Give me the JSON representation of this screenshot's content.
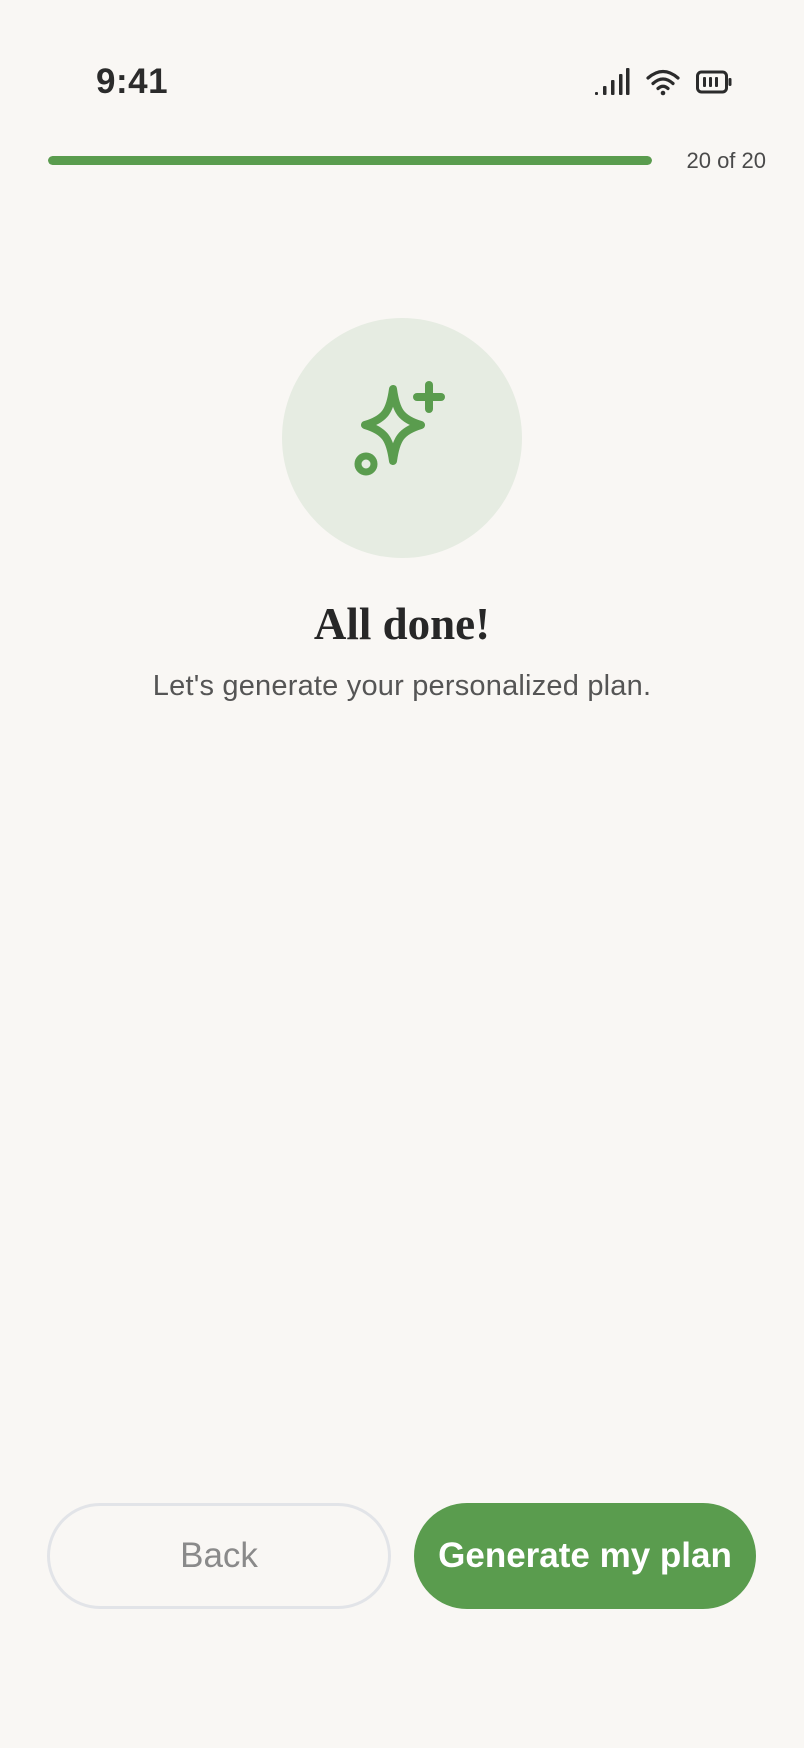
{
  "status_bar": {
    "time": "9:41",
    "icons": [
      "cellular-signal-icon",
      "wifi-icon",
      "battery-icon"
    ]
  },
  "progress": {
    "label": "20 of 20",
    "current": 20,
    "total": 20,
    "fraction": 1.0
  },
  "hero": {
    "icon": "sparkle-icon",
    "title": "All done!",
    "subtitle": "Let's generate your personalized plan."
  },
  "actions": {
    "back_label": "Back",
    "primary_label": "Generate my plan"
  },
  "colors": {
    "accent": "#5a9c4e",
    "background": "#f9f7f4",
    "icon_circle": "#e6ece2"
  }
}
